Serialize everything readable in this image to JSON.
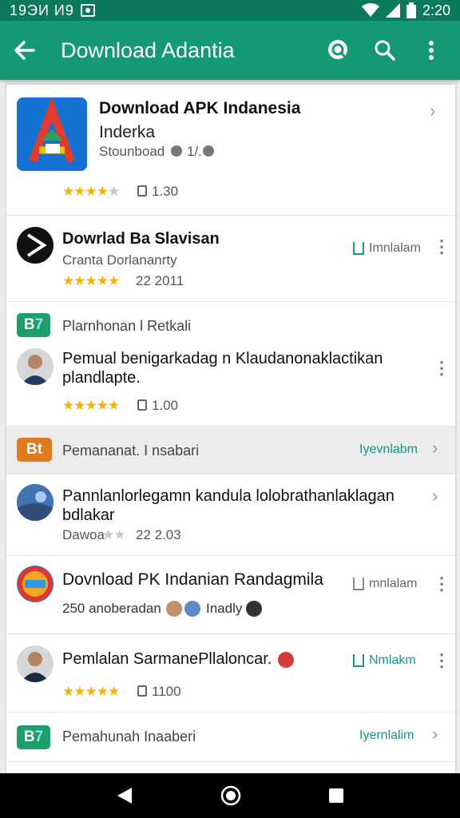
{
  "status_bar": {
    "left_text": "19ЭИ И9",
    "time": "2:20"
  },
  "toolbar": {
    "title": "Download Adantia"
  },
  "items": [
    {
      "title": "Download APK Indanesia",
      "subtitle": "Inderka",
      "meta_line": "Stounboad",
      "meta_extra": "1/.",
      "rating_count": "1.30"
    },
    {
      "title": "Dowrlad Ba Slavisan",
      "subtitle": "Cranta Dorlananrty",
      "rating_count": "22 2011",
      "action_label": "Imnlalam"
    },
    {
      "header": "Plarnhonan l Retkali",
      "title_line1": "Pemual benigarkadag n Klaudanonaklactikan",
      "title_line2": "plandlapte.",
      "rating_count": "1.00"
    },
    {
      "badge": "Bt",
      "title": "Pemananat. I nsabari",
      "action_label": "Iyevnlabm"
    },
    {
      "title_line1": "Pannlanlorlegamn kandula lolobrathanlaklagan",
      "title_line2": "bdlakar",
      "subtitle": "Dawoa",
      "rating_count": "22 2.03"
    },
    {
      "title": "Dovnload PK Indanian Randagmila",
      "meta_line": "250 anoberadan",
      "meta_extra": "Inadly",
      "action_label": "mnlalam"
    },
    {
      "title": "Pemlalan SarmanePllaloncar.",
      "rating_count": "1100",
      "action_label": "Nmlakm"
    },
    {
      "title": "Pemahunah Inaaberi",
      "action_label": "Iyernlalim"
    }
  ]
}
